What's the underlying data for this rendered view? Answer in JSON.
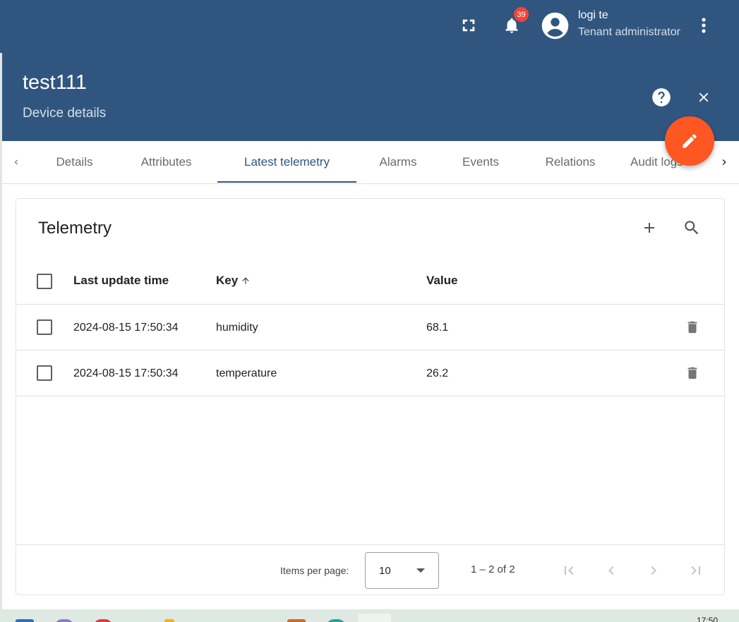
{
  "topbar": {
    "notifications_count": "39",
    "user_name": "logi te",
    "user_role": "Tenant administrator",
    "icons": [
      "fullscreen-icon",
      "bell-icon",
      "account-circle-icon",
      "more-vert-icon"
    ]
  },
  "details": {
    "title": "test111",
    "subtitle": "Device details",
    "icons": [
      "help-icon",
      "close-icon",
      "edit-icon"
    ]
  },
  "tabs": [
    {
      "label": "Details"
    },
    {
      "label": "Attributes"
    },
    {
      "label": "Latest telemetry"
    },
    {
      "label": "Alarms"
    },
    {
      "label": "Events"
    },
    {
      "label": "Relations"
    },
    {
      "label": "Audit logs"
    }
  ],
  "active_tab": "Latest telemetry",
  "telemetry": {
    "title": "Telemetry",
    "columns": {
      "last_update_time": "Last update time",
      "key": "Key",
      "value": "Value"
    },
    "sort": {
      "column": "Key",
      "direction": "ascending"
    },
    "rows": [
      {
        "time": "2024-08-15 17:50:34",
        "key": "humidity",
        "value": "68.1"
      },
      {
        "time": "2024-08-15 17:50:34",
        "key": "temperature",
        "value": "26.2"
      }
    ]
  },
  "paginator": {
    "items_per_page_label": "Items per page:",
    "page_size": "10",
    "range_label": "1 – 2 of 2"
  },
  "taskbar": {
    "clock": "17:50"
  },
  "colors": {
    "primary": "#305680",
    "accent": "#ff5722",
    "badge": "#f44336"
  }
}
